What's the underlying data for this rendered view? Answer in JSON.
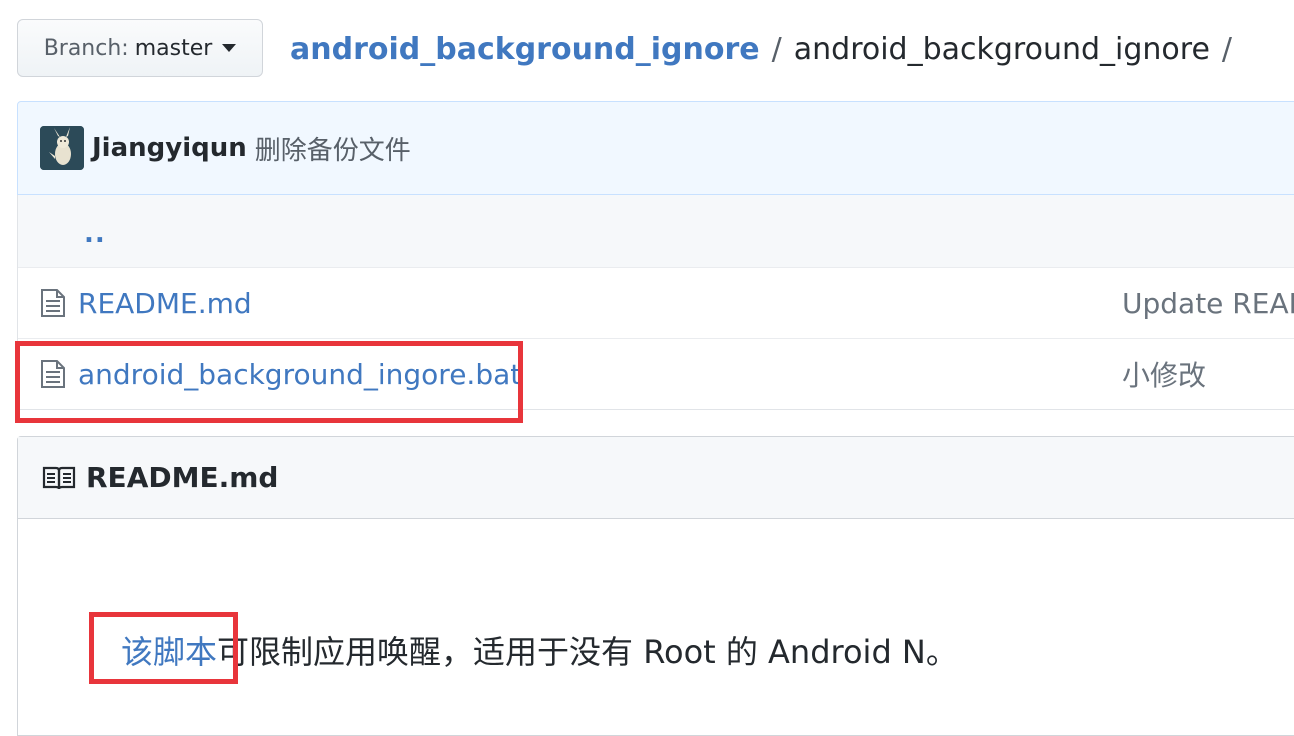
{
  "branch": {
    "prefix": "Branch:",
    "name": "master"
  },
  "breadcrumb": {
    "repo": "android_background_ignore",
    "separator": "/",
    "dir": "android_background_ignore",
    "trailing_separator": "/"
  },
  "commit": {
    "author": "Jiangyiqun",
    "message": "删除备份文件"
  },
  "files": {
    "up": "..",
    "rows": [
      {
        "name": "README.md",
        "message": "Update READM"
      },
      {
        "name": "android_background_ingore.bat",
        "message": "小修改"
      }
    ]
  },
  "readme": {
    "title": "README.md",
    "highlight": "该脚本",
    "text": "可限制应用唤醒，适用于没有 Root 的 Android N。"
  },
  "annotation_color": "#e8353b"
}
